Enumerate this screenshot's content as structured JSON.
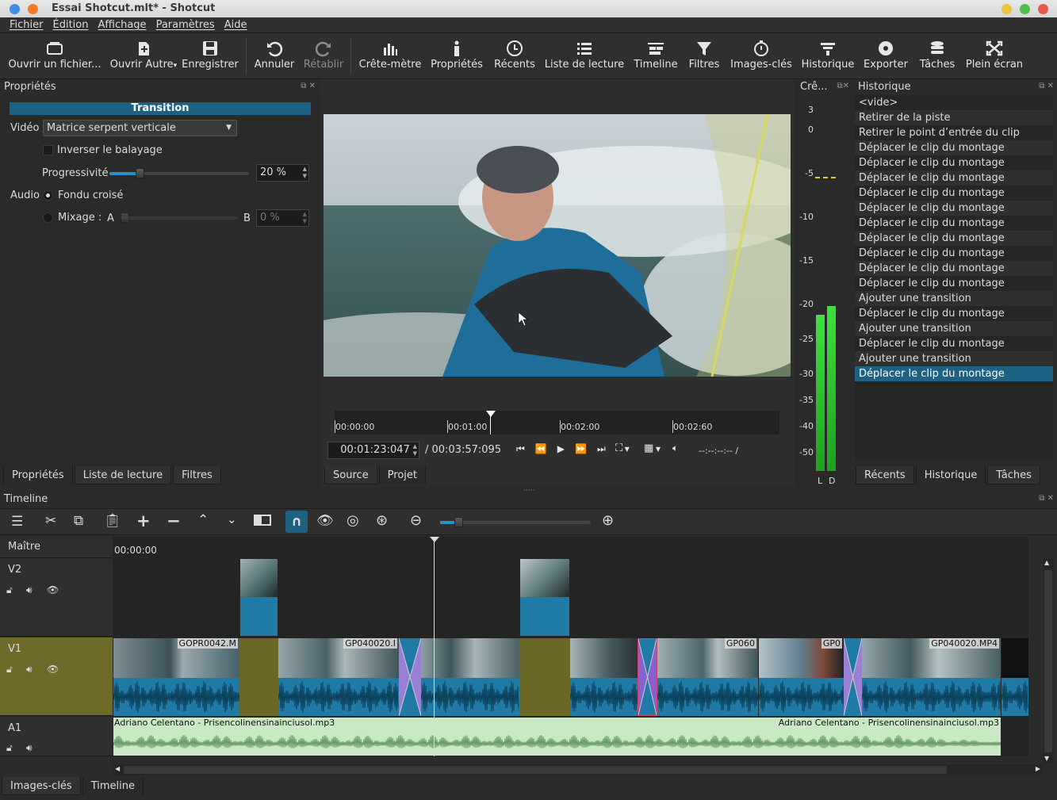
{
  "window": {
    "title": "Essai Shotcut.mlt* - Shotcut"
  },
  "menu": [
    "Fichier",
    "Édition",
    "Affichage",
    "Paramètres",
    "Aide"
  ],
  "toolbar": {
    "open_file": "Ouvrir un fichier...",
    "open_other": "Ouvrir Autre",
    "save": "Enregistrer",
    "undo": "Annuler",
    "redo": "Rétablir",
    "peak_meter": "Crête-mètre",
    "properties": "Propriétés",
    "recent": "Récents",
    "playlist": "Liste de lecture",
    "timeline": "Timeline",
    "filters": "Filtres",
    "keyframes": "Images-clés",
    "history": "Historique",
    "export": "Exporter",
    "jobs": "Tâches",
    "fullscreen": "Plein écran"
  },
  "properties": {
    "title": "Propriétés",
    "header": "Transition",
    "video_label": "Vidéo",
    "video_value": "Matrice serpent verticale",
    "invert_label": "Inverser le balayage",
    "softness_label": "Progressivité",
    "softness_value": "20 %",
    "softness_level": 0.2,
    "audio_label": "Audio",
    "crossfade_label": "Fondu croisé",
    "mix_label": "Mixage :",
    "mix_a": "A",
    "mix_b": "B",
    "mix_value": "0 %",
    "tabs": [
      "Propriétés",
      "Liste de lecture",
      "Filtres"
    ]
  },
  "player": {
    "ruler": [
      "00:00:00",
      "00:01:00",
      "00:02:00",
      "00:02:60"
    ],
    "position": "00:01:23:047",
    "duration": "/ 00:03:57:095",
    "in_out": "--:--:--:-- /",
    "tabs": [
      "Source",
      "Projet"
    ]
  },
  "meter": {
    "title": "Crê...",
    "scale": [
      "3",
      "0",
      "-5",
      "-10",
      "-15",
      "-20",
      "-25",
      "-30",
      "-35",
      "-40",
      "-50"
    ],
    "channels": [
      "L",
      "D"
    ],
    "level_l": 0.73,
    "level_r": 0.77
  },
  "history": {
    "title": "Historique",
    "items": [
      "<vide>",
      "Retirer de la piste",
      "Retirer le point d’entrée du clip",
      "Déplacer le clip du montage",
      "Déplacer le clip du montage",
      "Déplacer le clip du montage",
      "Déplacer le clip du montage",
      "Déplacer le clip du montage",
      "Déplacer le clip du montage",
      "Déplacer le clip du montage",
      "Déplacer le clip du montage",
      "Déplacer le clip du montage",
      "Déplacer le clip du montage",
      "Ajouter une transition",
      "Déplacer le clip du montage",
      "Ajouter une transition",
      "Déplacer le clip du montage",
      "Ajouter une transition",
      "Déplacer le clip du montage"
    ],
    "selected": 18,
    "tabs": [
      "Récents",
      "Historique",
      "Tâches"
    ]
  },
  "timeline": {
    "title": "Timeline",
    "timecode": "00:00:00",
    "master": "Maître",
    "tracks": [
      "V2",
      "V1",
      "A1"
    ],
    "clip_names": [
      "GOPR0042.M",
      "GP040020.I",
      "GP060",
      "GP0",
      "GP040020.MP4"
    ],
    "audio_clip_left": "Adriano Celentano - Prisencolinensinainciusol.mp3",
    "audio_clip_right": "Adriano Celentano - Prisencolinensinainciusol.mp3",
    "bottom_tabs": [
      "Images-clés",
      "Timeline"
    ]
  },
  "colors": {
    "accent": "#1e6283",
    "selected_track": "#6e6a2a",
    "waveform": "#1f7aa6",
    "transition": "#9b7fd6"
  }
}
